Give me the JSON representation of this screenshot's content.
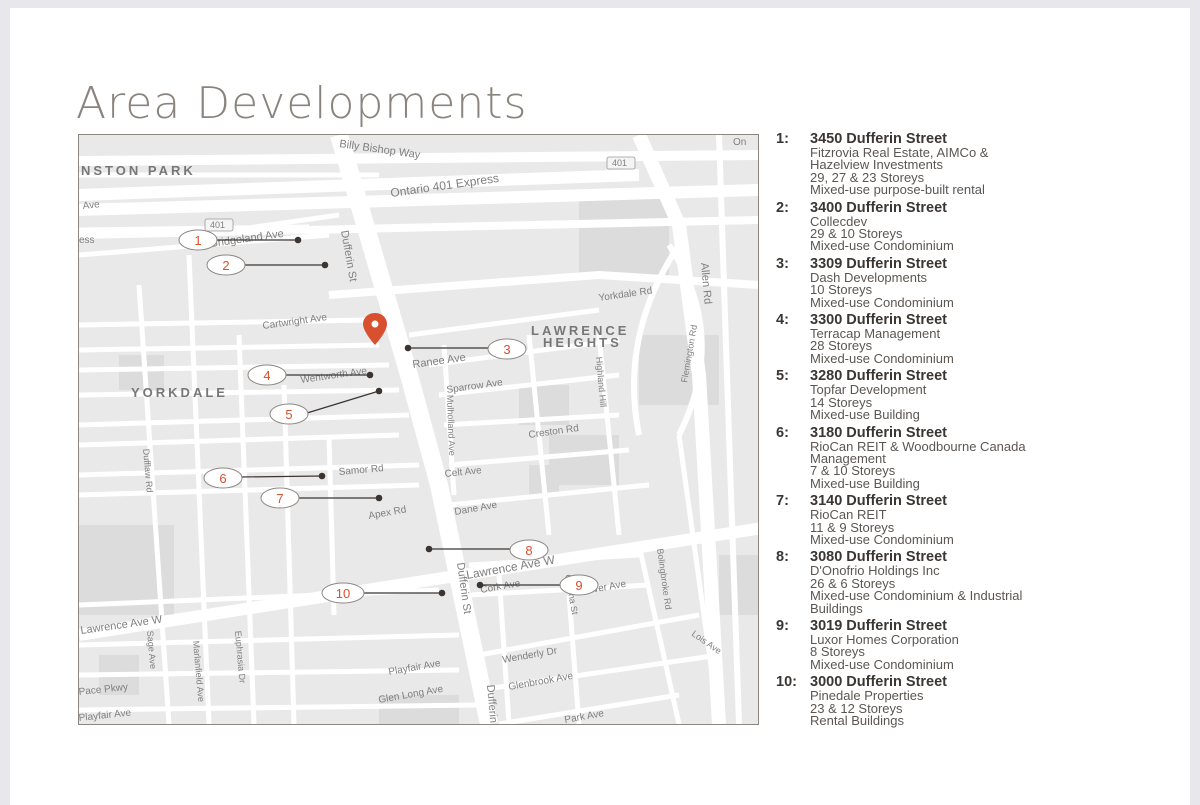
{
  "title": "Area Developments",
  "map": {
    "street_labels": [
      "Billy Bishop Way",
      "Ontario 401 Express",
      "401",
      "401",
      "Bridgeland Ave",
      "Dufferin St",
      "Yorkdale Rd",
      "Allen Rd",
      "Cartwright Ave",
      "Ranee Ave",
      "Sparrow Ave",
      "Highland Hill",
      "Flemington Rd",
      "Wentworth Ave",
      "Mulholland Ave",
      "Creston Rd",
      "Samor Rd",
      "Celt Ave",
      "Dufflaw Rd",
      "Apex Rd",
      "Dane Ave",
      "Lawrence Ave W",
      "Cork Ave",
      "Corona St",
      "Culver Ave",
      "Bolingbroke Rd",
      "Dufferin St",
      "Lawrence Ave W",
      "Sage Ave",
      "Marlanfield Ave",
      "Euphrasia Dr",
      "Wenderly Dr",
      "Playfair Ave",
      "Lois Ave",
      "Glenbrook Ave",
      "Glen Long Ave",
      "Dufferin St",
      "Park Ave",
      "Pace Pkwy",
      "Playfair Ave",
      "Ave",
      "ess",
      "On"
    ],
    "area_labels": [
      "NSTON PARK",
      "YORKDALE",
      "LAWRENCE",
      "HEIGHTS"
    ],
    "marker_numbers": [
      "1",
      "2",
      "3",
      "4",
      "5",
      "6",
      "7",
      "8",
      "9",
      "10"
    ],
    "location_pin": "location-pin-icon",
    "colors": {
      "marker": "#d9502e",
      "pin": "#d9502e",
      "leader": "#3b3531",
      "land": "#e9e9e9",
      "road": "#ffffff"
    }
  },
  "developments": [
    {
      "num": "1:",
      "address": "3450 Dufferin Street",
      "lines": [
        "Fitzrovia Real Estate, AIMCo &",
        "Hazelview Investments",
        "29, 27 & 23 Storeys",
        "Mixed-use purpose-built rental"
      ]
    },
    {
      "num": "2:",
      "address": "3400 Dufferin Street",
      "lines": [
        "Collecdev",
        "29 & 10 Storeys",
        "Mixed-use Condominium"
      ]
    },
    {
      "num": "3:",
      "address": "3309 Dufferin Street",
      "lines": [
        "Dash Developments",
        "10 Storeys",
        "Mixed-use Condominium"
      ]
    },
    {
      "num": "4:",
      "address": "3300 Dufferin Street",
      "lines": [
        "Terracap Management",
        "28 Storeys",
        "Mixed-use Condominium"
      ]
    },
    {
      "num": "5:",
      "address": "3280 Dufferin Street",
      "lines": [
        "Topfar Development",
        "14 Storeys",
        "Mixed-use Building"
      ]
    },
    {
      "num": "6:",
      "address": "3180 Dufferin Street",
      "lines": [
        "RioCan REIT & Woodbourne Canada",
        "Management",
        "7 & 10 Storeys",
        "Mixed-use Building"
      ]
    },
    {
      "num": "7:",
      "address": "3140 Dufferin Street",
      "lines": [
        "RioCan REIT",
        "11 & 9 Storeys",
        "Mixed-use Condominium"
      ]
    },
    {
      "num": "8:",
      "address": "3080 Dufferin Street",
      "lines": [
        "D'Onofrio Holdings Inc",
        "26 & 6 Storeys",
        "Mixed-use Condominium & Industrial",
        "Buildings"
      ]
    },
    {
      "num": "9:",
      "address": "3019 Dufferin Street",
      "lines": [
        "Luxor Homes Corporation",
        "8 Storeys",
        "Mixed-use Condominium"
      ]
    },
    {
      "num": "10:",
      "address": "3000 Dufferin Street",
      "lines": [
        "Pinedale Properties",
        "23 & 12 Storeys",
        "Rental Buildings"
      ]
    }
  ]
}
